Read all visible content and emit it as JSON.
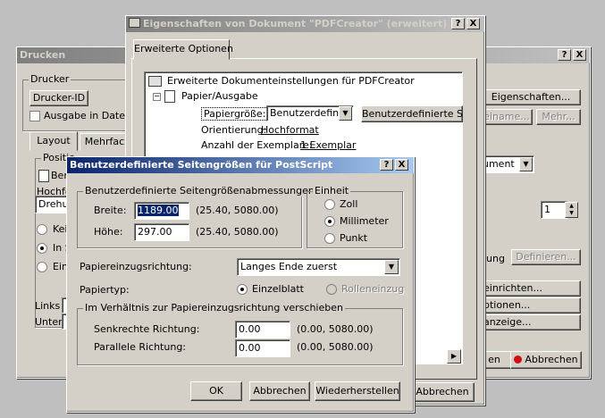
{
  "drucken": {
    "title": "Drucken",
    "drucker_group": "Drucker",
    "drucker_id_btn": "Drucker-ID",
    "ausgabe_label": "Ausgabe in Datei:",
    "tab_layout": "Layout",
    "tab_mehrfach": "Mehrfac",
    "position_group": "Positio",
    "ben_label": "Ben",
    "hochfo_label": "Hochfo",
    "drehung_value": "Drehun",
    "radio1": "Kei",
    "radio2": "In S",
    "radio3": "Ein",
    "links_label": "Links",
    "unten_label": "Unten",
    "eigenschaften_btn": "Eigenschaften...",
    "dateiname_btn": "einame...",
    "mehr_btn": "Mehr...",
    "dokument_value": "ument",
    "copies_value": "1",
    "lung_label": "lung",
    "definieren_btn": "Definieren...",
    "einrichten_btn": "einrichten...",
    "optionen_btn": "ptionen...",
    "anzeige_btn": "anzeige...",
    "en_btn": "en",
    "abbrechen_btn": "Abbrechen"
  },
  "eigenschaften": {
    "title": "Eigenschaften von Dokument \"PDFCreator\" (erweitert)",
    "tab": "Erweiterte Optionen",
    "tree_root": "Erweiterte Dokumenteinstellungen für PDFCreator",
    "tree_papier": "Papier/Ausgabe",
    "papiergroesse_label": "Papiergröße:",
    "papiergroesse_value": "Benutzerdefinie",
    "benutzerdef_btn": "Benutzerdefinierte Sei",
    "orientierung_label": "Orientierung:",
    "orientierung_value": "Hochformat",
    "anzahl_label": "Anzahl der Exemplare:",
    "anzahl_value": "1 Exemplar",
    "abbrechen_btn": "Abbrechen"
  },
  "custom": {
    "title": "Benutzerdefinierte Seitengrößen für PostScript",
    "dim_group": "Benutzerdefinierte Seitengrößenabmessungen",
    "breite_label": "Breite:",
    "breite_value": "1189.00",
    "breite_range": "(25.40, 5080.00)",
    "hoehe_label": "Höhe:",
    "hoehe_value": "297.00",
    "hoehe_range": "(25.40, 5080.00)",
    "einheit_group": "Einheit",
    "unit_zoll": "Zoll",
    "unit_mm": "Millimeter",
    "unit_punkt": "Punkt",
    "einzug_label": "Papiereinzugsrichtung:",
    "einzug_value": "Langes Ende zuerst",
    "papiertyp_label": "Papiertyp:",
    "einzelblatt": "Einzelblatt",
    "rolleneinzug": "Rolleneinzug",
    "offset_group": "Im Verhältnis zur Papiereinzugsrichtung verschieben",
    "senkrecht_label": "Senkrechte Richtung:",
    "senkrecht_value": "0.00",
    "senkrecht_range": "(0.00, 5080.00)",
    "parallel_label": "Parallele Richtung:",
    "parallel_value": "0.00",
    "parallel_range": "(0.00, 5080.00)",
    "ok_btn": "OK",
    "abbrechen_btn": "Abbrechen",
    "wiederherstellen_btn": "Wiederherstellen"
  },
  "title_buttons": {
    "help": "?",
    "close": "X"
  }
}
